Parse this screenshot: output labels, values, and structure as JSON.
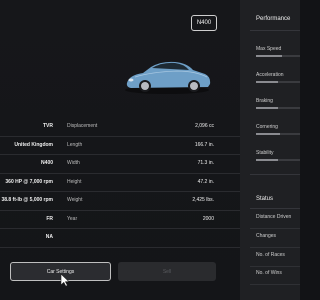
{
  "header": {
    "model_code": "N400"
  },
  "specs": {
    "rows": [
      {
        "left_value": "TVR",
        "right_label": "Displacement",
        "right_value": "2,096 cc"
      },
      {
        "left_value": "United Kingdom",
        "right_label": "Length",
        "right_value": "166.7 in."
      },
      {
        "left_value": "N400",
        "right_label": "Width",
        "right_value": "71.3 in."
      },
      {
        "left_value": "360 HP @ 7,000 rpm",
        "right_label": "Height",
        "right_value": "47.2 in."
      },
      {
        "left_value": "38.8 ft-lb @ 5,000 rpm",
        "right_label": "Weight",
        "right_value": "2,425 lbs."
      },
      {
        "left_value": "FR",
        "right_label": "Year",
        "right_value": "2000"
      },
      {
        "left_value": "NA",
        "right_label": "",
        "right_value": ""
      }
    ]
  },
  "buttons": {
    "car_settings": "Car Settings",
    "secondary": "Sell"
  },
  "sidebar": {
    "performance_title": "Performance",
    "performance": [
      {
        "label": "Max Speed",
        "level": 0.6
      },
      {
        "label": "Acceleration",
        "level": 0.5
      },
      {
        "label": "Braking",
        "level": 0.5
      },
      {
        "label": "Cornering",
        "level": 0.55
      },
      {
        "label": "Stability",
        "level": 0.5
      }
    ],
    "status_title": "Status",
    "status": [
      "Distance Driven",
      "Changes",
      "No. of Races",
      "No. of Wins"
    ]
  },
  "colors": {
    "car_body": "#6e9fc7",
    "background": "#121316",
    "sidebar": "#1f2023"
  }
}
